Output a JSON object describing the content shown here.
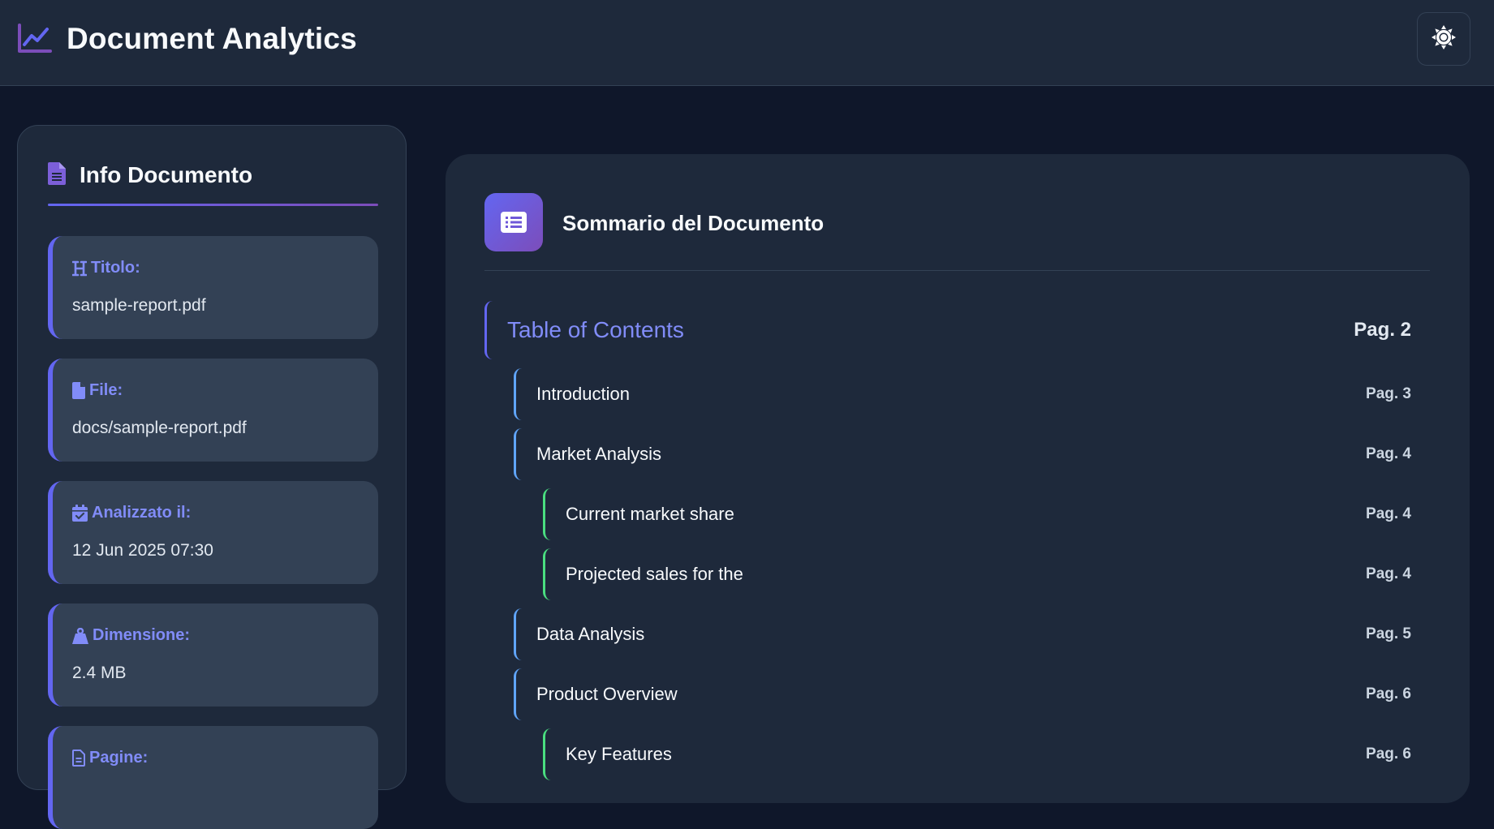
{
  "header": {
    "title": "Document Analytics",
    "logo_icon": "chart-line-icon",
    "theme_toggle_icon": "sun-icon"
  },
  "sidebar": {
    "title": "Info Documento",
    "title_icon": "document-icon",
    "items": [
      {
        "label": "Titolo:",
        "value": "sample-report.pdf",
        "icon": "heading-icon"
      },
      {
        "label": "File:",
        "value": "docs/sample-report.pdf",
        "icon": "file-icon"
      },
      {
        "label": "Analizzato il:",
        "value": "12 Jun 2025 07:30",
        "icon": "calendar-check-icon"
      },
      {
        "label": "Dimensione:",
        "value": "2.4 MB",
        "icon": "weight-icon"
      },
      {
        "label": "Pagine:",
        "value": "",
        "icon": "file-lines-icon"
      }
    ]
  },
  "summary": {
    "title": "Sommario del Documento",
    "icon": "list-icon",
    "toc": [
      {
        "label": "Table of Contents",
        "page": "Pag. 2",
        "level": 0
      },
      {
        "label": "Introduction",
        "page": "Pag. 3",
        "level": 1
      },
      {
        "label": "Market Analysis",
        "page": "Pag. 4",
        "level": 1
      },
      {
        "label": "Current market share",
        "page": "Pag. 4",
        "level": 2
      },
      {
        "label": "Projected sales for the",
        "page": "Pag. 4",
        "level": 2
      },
      {
        "label": "Data Analysis",
        "page": "Pag. 5",
        "level": 1
      },
      {
        "label": "Product Overview",
        "page": "Pag. 6",
        "level": 1
      },
      {
        "label": "Key Features",
        "page": "Pag. 6",
        "level": 2
      }
    ]
  },
  "colors": {
    "accent": "#6366f1",
    "accent_light": "#818cf8",
    "level1_border": "#60a5fa",
    "level2_border": "#4ade80",
    "background": "#0f172a",
    "surface": "#1e293b",
    "card": "#334155"
  }
}
